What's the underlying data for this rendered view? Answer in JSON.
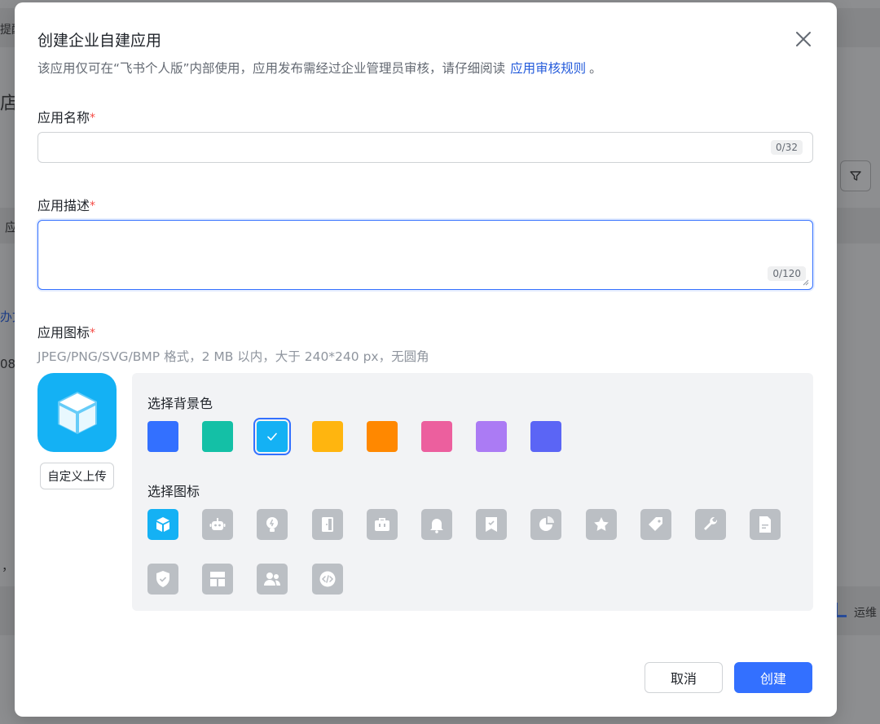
{
  "background_page": {
    "fragments": [
      "提醒",
      "店",
      "应",
      "办文",
      "08",
      "，",
      "运维"
    ]
  },
  "modal": {
    "title": "创建企业自建应用",
    "subtitle": {
      "text": "该应用仅可在“飞书个人版”内部使用，应用发布需经过企业管理员审核，请仔细阅读",
      "link": "应用审核规则",
      "tail": "。"
    },
    "name_field": {
      "label": "应用名称",
      "required_mark": "*",
      "value": "",
      "placeholder": "",
      "counter": "0/32"
    },
    "desc_field": {
      "label": "应用描述",
      "required_mark": "*",
      "value": "",
      "placeholder": "",
      "counter": "0/120"
    },
    "icon_field": {
      "label": "应用图标",
      "required_mark": "*",
      "hint": "JPEG/PNG/SVG/BMP 格式，2 MB 以内，大于 240*240 px，无圆角",
      "upload_label": "自定义上传",
      "bg_label": "选择背景色",
      "icon_label": "选择图标",
      "colors": [
        "#3370ff",
        "#14c0a6",
        "#14b1f4",
        "#ffb50f",
        "#ff8800",
        "#ec5f9e",
        "#ab7bf4",
        "#5b65f5"
      ],
      "selected_color_index": 2,
      "icons": [
        "cube-icon",
        "robot-icon",
        "bulb-icon",
        "door-icon",
        "briefcase-icon",
        "bell-icon",
        "bookmark-check-icon",
        "pie-chart-icon",
        "star-icon",
        "tag-icon",
        "wrench-icon",
        "document-icon",
        "shield-check-icon",
        "layout-icon",
        "users-icon",
        "code-icon"
      ],
      "selected_icon_index": 0
    },
    "cancel_label": "取消",
    "create_label": "创建"
  }
}
